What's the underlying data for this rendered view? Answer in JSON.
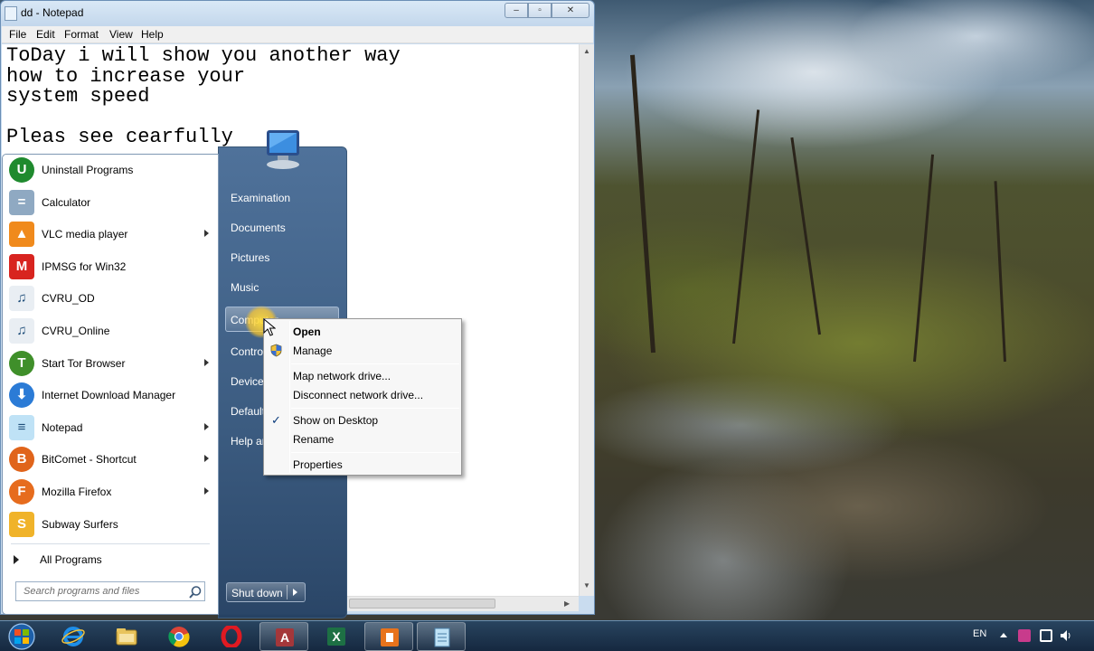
{
  "notepad": {
    "title": "dd - Notepad",
    "controls": {
      "minimize": "–",
      "maximize": "▫",
      "close": "✕"
    },
    "menu": [
      "File",
      "Edit",
      "Format",
      "View",
      "Help"
    ],
    "text": "ToDay i will show you another way\nhow to increase your\nsystem speed\n\nPleas see cearfully"
  },
  "start_menu": {
    "programs": [
      {
        "label": "Uninstall Programs",
        "icon": "uninstall-icon",
        "submenu": false
      },
      {
        "label": "Calculator",
        "icon": "calculator-icon",
        "submenu": false
      },
      {
        "label": "VLC media player",
        "icon": "vlc-icon",
        "submenu": true
      },
      {
        "label": "IPMSG for Win32",
        "icon": "ipmsg-icon",
        "submenu": false
      },
      {
        "label": "CVRU_OD",
        "icon": "shortcut-icon",
        "submenu": false
      },
      {
        "label": "CVRU_Online",
        "icon": "shortcut-icon",
        "submenu": false
      },
      {
        "label": "Start Tor Browser",
        "icon": "tor-icon",
        "submenu": true
      },
      {
        "label": "Internet Download Manager",
        "icon": "idm-icon",
        "submenu": false
      },
      {
        "label": "Notepad",
        "icon": "notepad-icon",
        "submenu": true
      },
      {
        "label": "BitComet - Shortcut",
        "icon": "bitcomet-icon",
        "submenu": true
      },
      {
        "label": "Mozilla Firefox",
        "icon": "firefox-icon",
        "submenu": true
      },
      {
        "label": "Subway Surfers",
        "icon": "subway-icon",
        "submenu": false
      }
    ],
    "all_programs": "All Programs",
    "search_placeholder": "Search programs and files",
    "right_pane": {
      "examination": "Examination",
      "documents": "Documents",
      "pictures": "Pictures",
      "music": "Music",
      "computer": "Computer",
      "control": "Contro",
      "devices": "Devices",
      "default": "Default",
      "help": "Help ar"
    },
    "shutdown": "Shut down"
  },
  "context_menu": {
    "open": "Open",
    "manage": "Manage",
    "map_network": "Map network drive...",
    "disconnect_network": "Disconnect network drive...",
    "show_on_desktop": "Show on Desktop",
    "show_on_desktop_checked": true,
    "check_mark": "✓",
    "rename": "Rename",
    "properties": "Properties"
  },
  "taskbar": {
    "apps": [
      "start-orb",
      "ie-icon",
      "explorer-icon",
      "chrome-icon",
      "opera-icon",
      "access-icon",
      "excel-icon",
      "vlc-taskbar-icon",
      "notepad-taskbar-icon"
    ],
    "language": "EN"
  }
}
